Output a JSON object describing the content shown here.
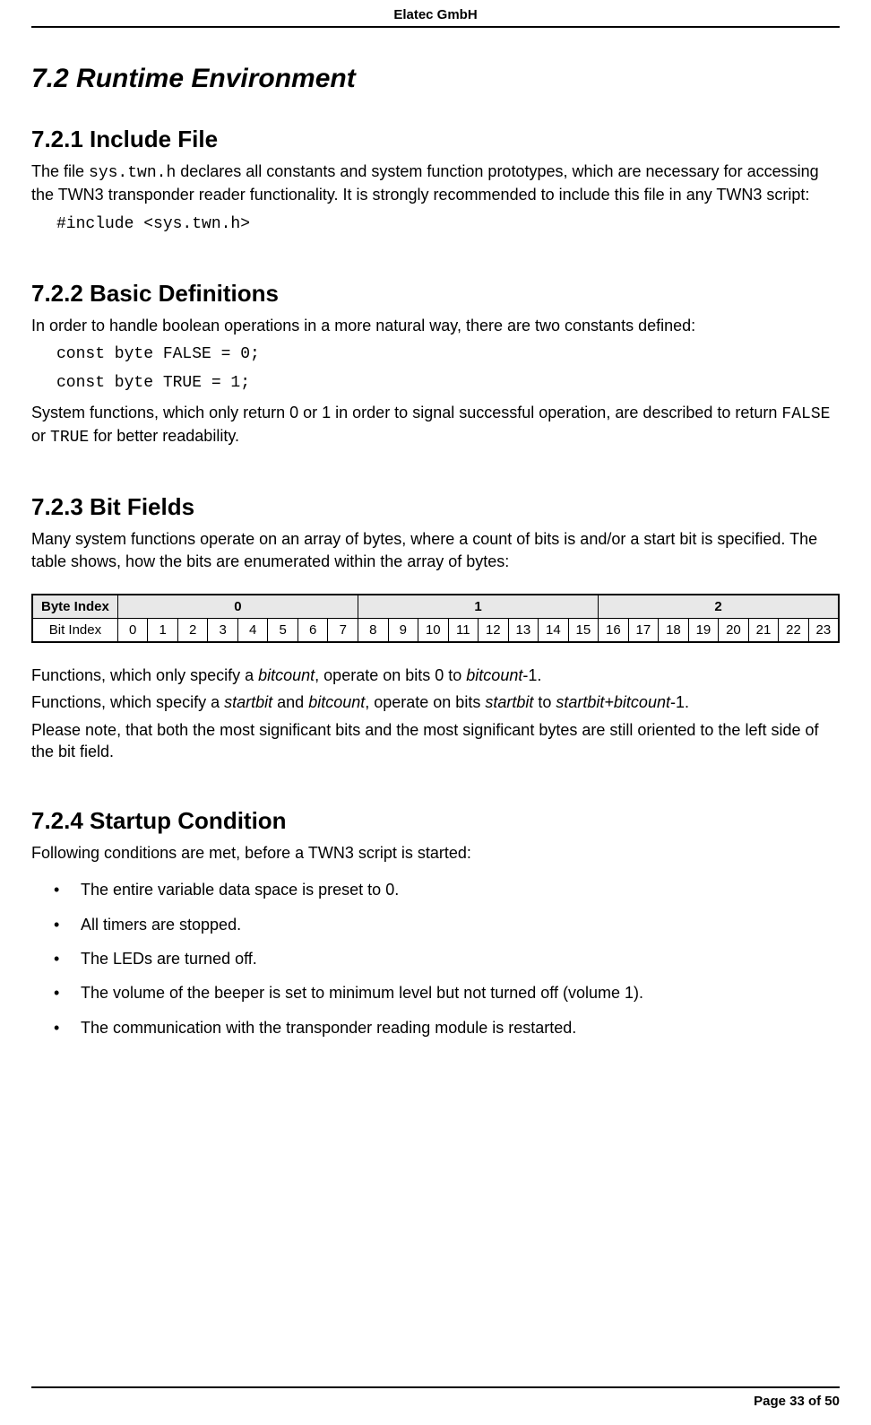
{
  "header": {
    "company": "Elatec GmbH"
  },
  "section_heading": "7.2 Runtime Environment",
  "sub1": {
    "heading": "7.2.1 Include File",
    "para_prefix": "The file ",
    "code_inline": "sys.twn.h",
    "para_suffix": " declares all constants and system function prototypes, which are necessary for accessing the TWN3 transponder reader functionality. It is strongly recommended to include this file in any TWN3 script:",
    "code_block": "#include <sys.twn.h>"
  },
  "sub2": {
    "heading": "7.2.2 Basic Definitions",
    "para1": "In order to handle boolean operations in a more natural way, there are two constants defined:",
    "code_line1": "const byte FALSE = 0;",
    "code_line2": "const byte TRUE = 1;",
    "para2_prefix": "System functions, which only return 0 or 1 in order to signal successful operation, are described to return ",
    "false_word": "FALSE",
    "para2_mid": " or ",
    "true_word": "TRUE",
    "para2_suffix": " for better readability."
  },
  "sub3": {
    "heading": "7.2.3 Bit Fields",
    "para1": "Many system functions operate on an array of bytes, where a count of bits is and/or a start bit is specified. The table shows, how the bits are enumerated within the array of bytes:",
    "table": {
      "byte_index_label": "Byte Index",
      "bit_index_label": "Bit Index",
      "byte_headers": [
        "0",
        "1",
        "2"
      ],
      "bit_values": [
        "0",
        "1",
        "2",
        "3",
        "4",
        "5",
        "6",
        "7",
        "8",
        "9",
        "10",
        "11",
        "12",
        "13",
        "14",
        "15",
        "16",
        "17",
        "18",
        "19",
        "20",
        "21",
        "22",
        "23"
      ]
    },
    "para2_a": "Functions, which only specify a ",
    "bitcount": "bitcount",
    "para2_b": ", operate on bits 0 to ",
    "para2_c": "-1.",
    "para3_a": "Functions, which specify a ",
    "startbit": "startbit",
    "para3_b": " and ",
    "para3_c": ", operate on bits ",
    "para3_d": " to ",
    "plus": "+",
    "para3_e": "-1.",
    "para4": "Please note, that both the most significant bits and the most significant bytes are still oriented to the left side of the bit field."
  },
  "sub4": {
    "heading": "7.2.4 Startup Condition",
    "para1": "Following conditions are met, before a TWN3 script is started:",
    "items": [
      "The entire variable data space is preset to 0.",
      "All timers are stopped.",
      "The LEDs are turned off.",
      "The volume of the beeper is set to minimum level but not turned off (volume 1).",
      "The communication with the transponder reading module is restarted."
    ]
  },
  "footer": {
    "page": "Page 33 of 50"
  }
}
